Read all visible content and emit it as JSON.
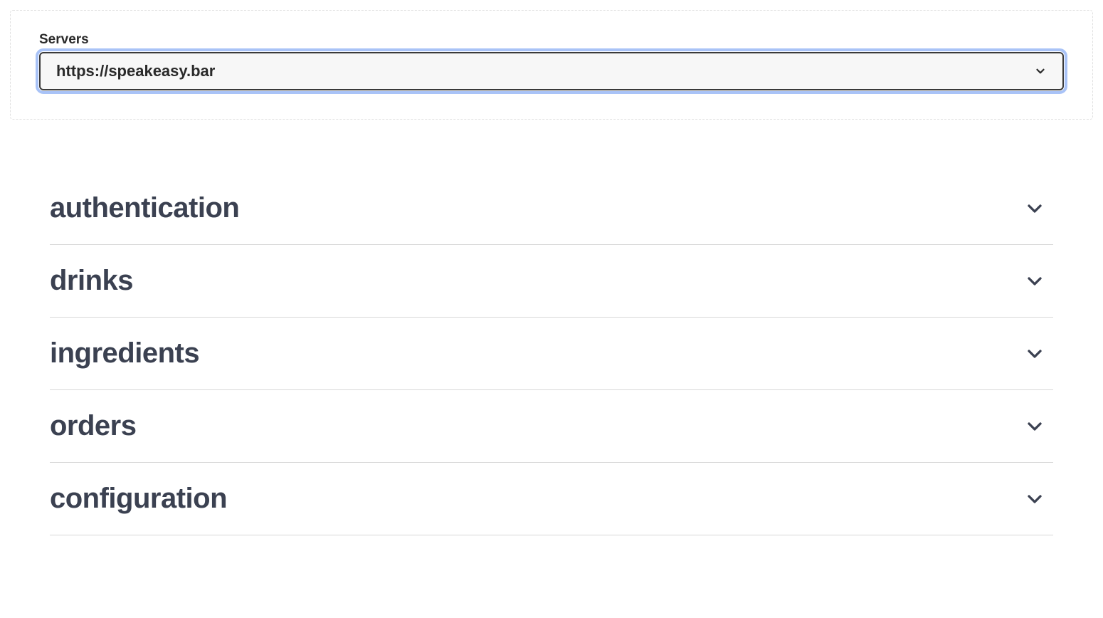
{
  "servers": {
    "label": "Servers",
    "selected": "https://speakeasy.bar"
  },
  "sections": [
    {
      "title": "authentication"
    },
    {
      "title": "drinks"
    },
    {
      "title": "ingredients"
    },
    {
      "title": "orders"
    },
    {
      "title": "configuration"
    }
  ]
}
